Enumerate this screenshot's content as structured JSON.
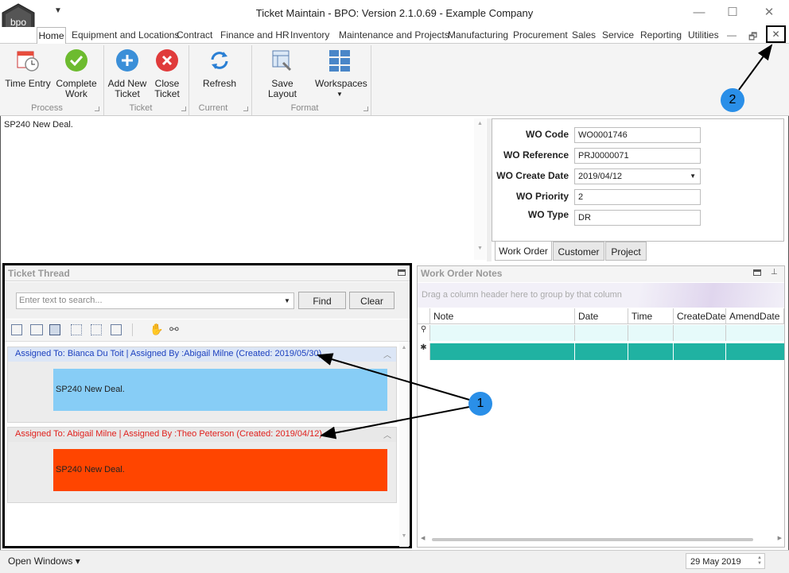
{
  "window": {
    "title": "Ticket Maintain - BPO: Version 2.1.0.69 - Example Company",
    "logo_text": "bpo",
    "controls": {
      "minimize": "—",
      "maximize": "☐",
      "close": "✕",
      "restore": "🗗",
      "dash": "—",
      "inner_close": "✕"
    }
  },
  "menu": {
    "items": [
      "Home",
      "Equipment and Locations",
      "Contract",
      "Finance and HR",
      "Inventory",
      "Maintenance and Projects",
      "Manufacturing",
      "Procurement",
      "Sales",
      "Service",
      "Reporting",
      "Utilities"
    ]
  },
  "ribbon": {
    "buttons": {
      "time_entry": "Time Entry",
      "complete_work_1": "Complete",
      "complete_work_2": "Work",
      "add_new_ticket_1": "Add New",
      "add_new_ticket_2": "Ticket",
      "close_ticket_1": "Close",
      "close_ticket_2": "Ticket",
      "refresh": "Refresh",
      "save_layout": "Save Layout",
      "workspaces": "Workspaces"
    },
    "groups": {
      "process": "Process",
      "ticket": "Ticket",
      "current": "Current",
      "format": "Format"
    }
  },
  "description": {
    "text": "SP240 New Deal."
  },
  "work_order": {
    "fields": {
      "wo_code_label": "WO Code",
      "wo_code": "WO0001746",
      "wo_reference_label": "WO Reference",
      "wo_reference": "PRJ0000071",
      "wo_create_date_label": "WO Create Date",
      "wo_create_date": "2019/04/12",
      "wo_priority_label": "WO Priority",
      "wo_priority": "2",
      "wo_type_label": "WO Type",
      "wo_type": "DR"
    },
    "tabs": {
      "work_order": "Work Order",
      "customer": "Customer",
      "project": "Project"
    }
  },
  "ticket_thread": {
    "title": "Ticket Thread",
    "search_placeholder": "Enter text to search...",
    "find": "Find",
    "clear": "Clear",
    "items": [
      {
        "header": "Assigned To: Bianca Du Toit | Assigned By :Abigail Milne (Created: 2019/05/30)",
        "body": "SP240 New Deal.",
        "header_color": "#1a3fbf",
        "body_color": "#87cdf6"
      },
      {
        "header": "Assigned To: Abigail Milne | Assigned By :Theo Peterson (Created: 2019/04/12)",
        "body": "SP240 New Deal.",
        "header_color": "#e0201c",
        "body_color": "#ff4500"
      }
    ]
  },
  "work_order_notes": {
    "title": "Work Order Notes",
    "group_hint": "Drag a column header here to group by that column",
    "columns": [
      "Note",
      "Date",
      "Time",
      "CreateDate",
      "AmendDate"
    ],
    "filter_indicator": "⚲",
    "new_row_indicator": "✱"
  },
  "status_bar": {
    "open_windows": "Open Windows ▾",
    "date": "29 May 2019"
  },
  "annotations": {
    "callout_1": "1",
    "callout_2": "2"
  },
  "colors": {
    "new_row": "#20b2a2",
    "callout": "#2a8fe8"
  }
}
